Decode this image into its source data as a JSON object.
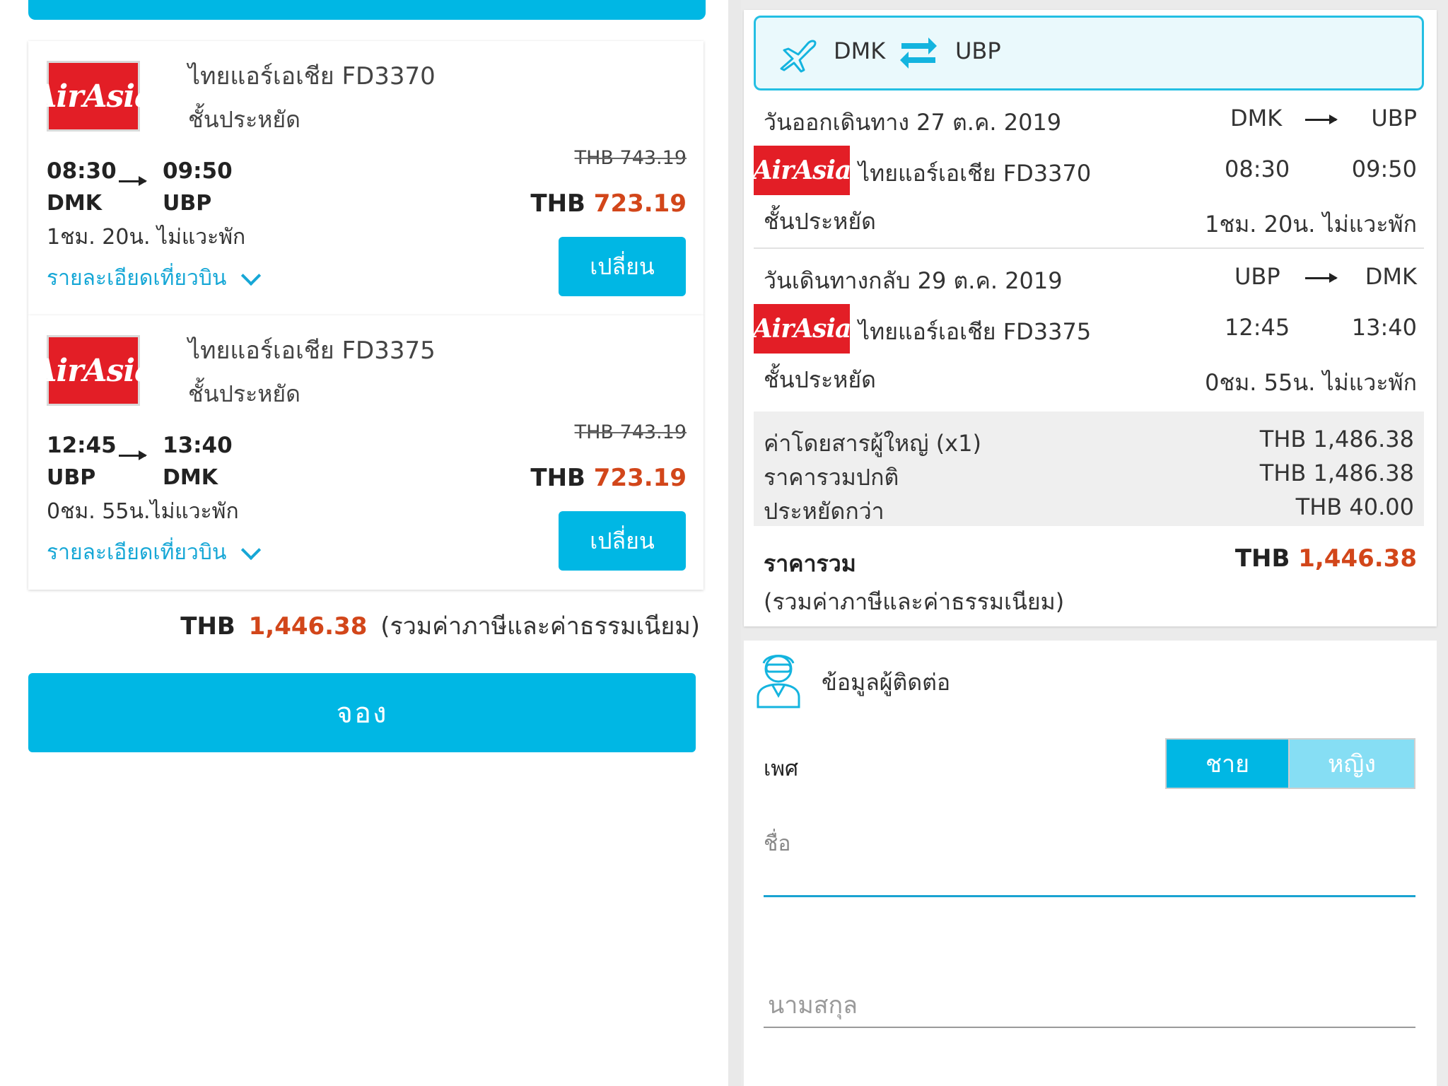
{
  "left": {
    "flights": [
      {
        "airline_logo": "AirAsia",
        "airline": "ไทยแอร์เอเชีย  FD3370",
        "class": "ชั้นประหยัด",
        "depart_time": "08:30",
        "arrive_time": "09:50",
        "from": "DMK",
        "to": "UBP",
        "duration": "1ชม. 20น. ไม่แวะพัก",
        "details_link": "รายละเอียดเที่ยวบิน",
        "old_price": "THB 743.19",
        "currency": "THB",
        "price": "723.19",
        "change_label": "เปลี่ยน"
      },
      {
        "airline_logo": "AirAsia",
        "airline": "ไทยแอร์เอเชีย  FD3375",
        "class": "ชั้นประหยัด",
        "depart_time": "12:45",
        "arrive_time": "13:40",
        "from": "UBP",
        "to": "DMK",
        "duration": "0ชม. 55น.ไม่แวะพัก",
        "details_link": "รายละเอียดเที่ยวบิน",
        "old_price": "THB 743.19",
        "currency": "THB",
        "price": "723.19",
        "change_label": "เปลี่ยน"
      }
    ],
    "total_currency": "THB",
    "total_price": "1,446.38",
    "total_note": "(รวมค่าภาษีและค่าธรรมเนียม)",
    "book_label": "จอง"
  },
  "right": {
    "route": {
      "from": "DMK",
      "to": "UBP"
    },
    "outbound": {
      "date_label": "วันออกเดินทาง 27 ต.ค. 2019",
      "from": "DMK",
      "to": "UBP",
      "airline_logo": "AirAsia",
      "airline": "ไทยแอร์เอเชีย  FD3370",
      "depart_time": "08:30",
      "arrive_time": "09:50",
      "class": "ชั้นประหยัด",
      "duration": "1ชม. 20น. ไม่แวะพัก"
    },
    "return": {
      "date_label": "วันเดินทางกลับ 29 ต.ค. 2019",
      "from": "UBP",
      "to": "DMK",
      "airline_logo": "AirAsia",
      "airline": "ไทยแอร์เอเชีย  FD3375",
      "depart_time": "12:45",
      "arrive_time": "13:40",
      "class": "ชั้นประหยัด",
      "duration": "0ชม. 55น. ไม่แวะพัก"
    },
    "fares": [
      {
        "label": "ค่าโดยสารผู้ใหญ่ (x1)",
        "value": "THB 1,486.38"
      },
      {
        "label": "ราคารวมปกติ",
        "value": "THB 1,486.38"
      },
      {
        "label": "ประหยัดกว่า",
        "value": "THB 40.00"
      }
    ],
    "total_label": "ราคารวม",
    "total_currency": "THB",
    "total_price": "1,446.38",
    "total_note": "(รวมค่าภาษีและค่าธรรมเนียม)",
    "contact": {
      "title": "ข้อมูลผู้ติดต่อ",
      "gender_label": "เพศ",
      "gender_male": "ชาย",
      "gender_female": "หญิง",
      "first_name_label": "ชื่อ",
      "last_name_placeholder": "นามสกุล"
    }
  },
  "colors": {
    "accent": "#00b7e4",
    "price_red": "#d2461a",
    "airasia_red": "#e31e26"
  }
}
